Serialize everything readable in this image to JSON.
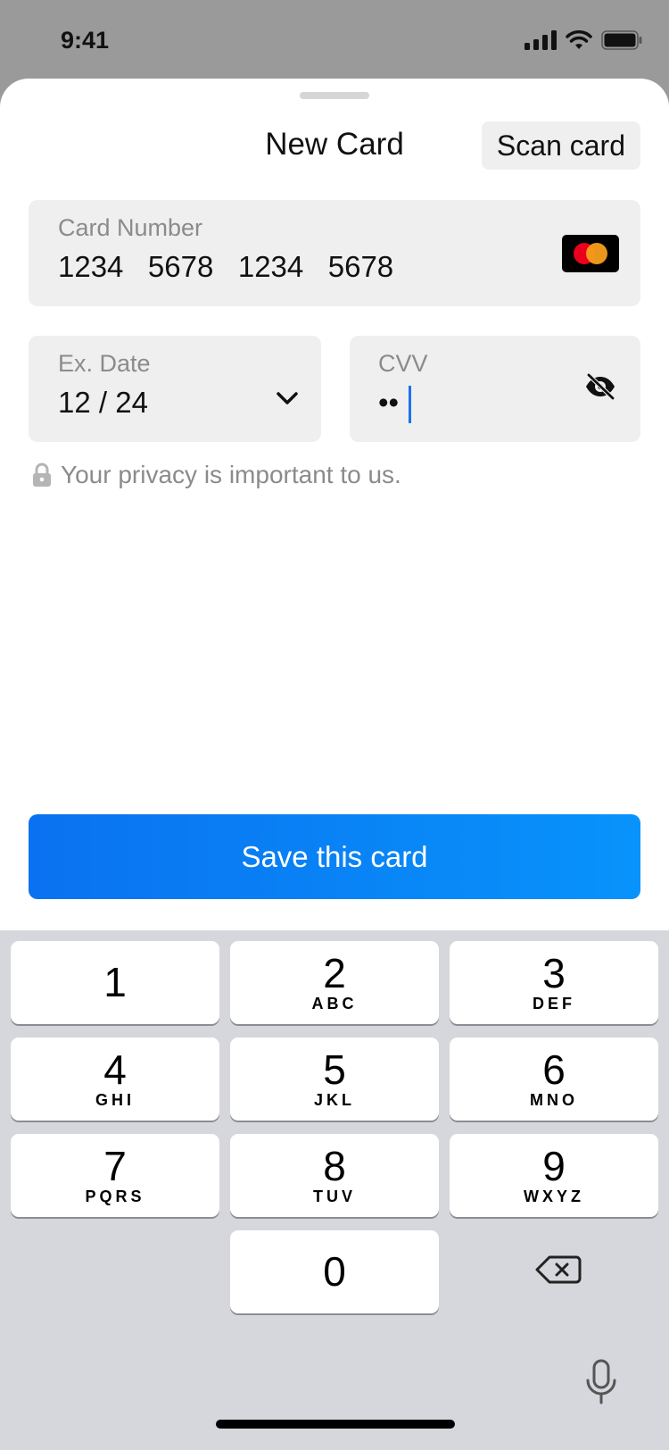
{
  "status_bar": {
    "time": "9:41"
  },
  "sheet": {
    "title": "New Card",
    "scan_button_label": "Scan card"
  },
  "card_number": {
    "label": "Card Number",
    "value": "1234   5678   1234   5678",
    "brand_icon": "mastercard-icon"
  },
  "expiry": {
    "label": "Ex. Date",
    "value": "12 / 24",
    "icon": "chevron-down-icon"
  },
  "cvv": {
    "label": "CVV",
    "masked_value": "••",
    "icon": "eye-slash-icon"
  },
  "privacy_note": "Your privacy is important to us.",
  "save_button_label": "Save this card",
  "colors": {
    "accent_start": "#0a72f0",
    "accent_end": "#0893fb",
    "caret": "#1a73e8"
  },
  "keypad": {
    "keys": [
      {
        "digit": "1",
        "letters": ""
      },
      {
        "digit": "2",
        "letters": "ABC"
      },
      {
        "digit": "3",
        "letters": "DEF"
      },
      {
        "digit": "4",
        "letters": "GHI"
      },
      {
        "digit": "5",
        "letters": "JKL"
      },
      {
        "digit": "6",
        "letters": "MNO"
      },
      {
        "digit": "7",
        "letters": "PQRS"
      },
      {
        "digit": "8",
        "letters": "TUV"
      },
      {
        "digit": "9",
        "letters": "WXYZ"
      },
      {
        "digit": "0",
        "letters": ""
      }
    ],
    "delete_icon": "backspace-icon",
    "dictation_icon": "microphone-icon"
  }
}
